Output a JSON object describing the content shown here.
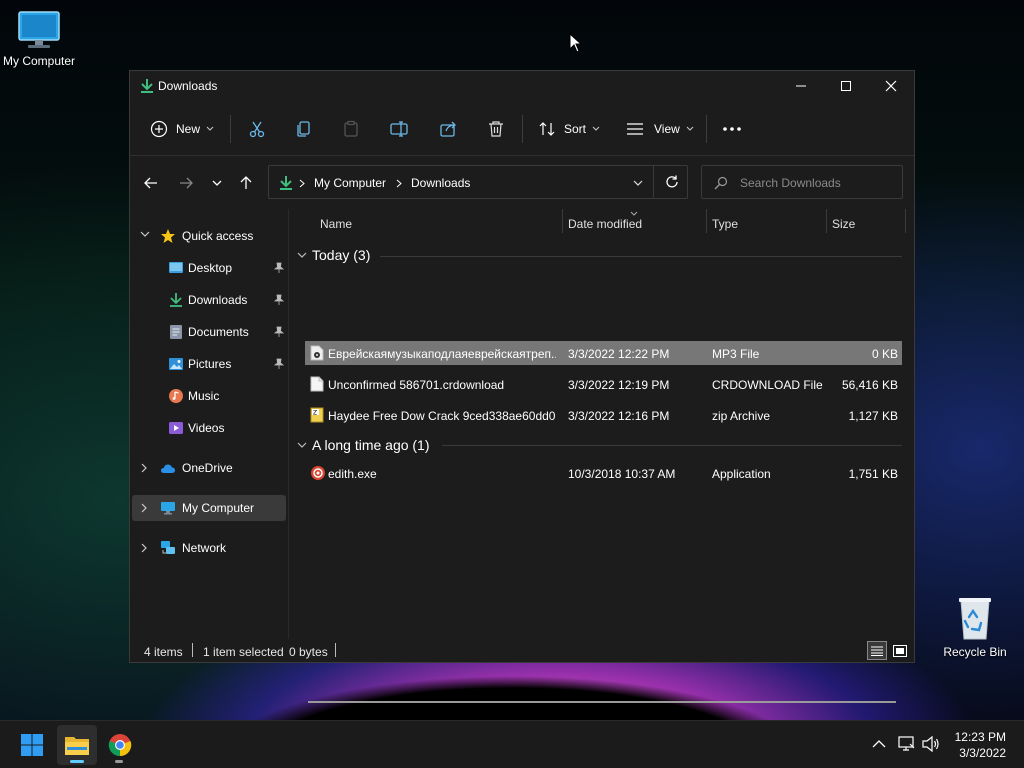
{
  "desktop": {
    "icons": [
      {
        "label": "My Computer",
        "icon": "computer-icon"
      },
      {
        "label": "Recycle Bin",
        "icon": "recycle-bin-icon"
      }
    ]
  },
  "window": {
    "title": "Downloads",
    "controls": [
      "minimize-icon",
      "maximize-icon",
      "close-icon"
    ]
  },
  "toolbar": {
    "new_label": "New",
    "sort_label": "Sort",
    "view_label": "View",
    "icons": [
      "cut-icon",
      "copy-icon",
      "paste-icon",
      "rename-icon",
      "share-icon",
      "delete-icon",
      "more-icon"
    ]
  },
  "address": {
    "segments": [
      "My Computer",
      "Downloads"
    ]
  },
  "search": {
    "placeholder": "Search Downloads"
  },
  "sidebar": {
    "quick_access": "Quick access",
    "items": [
      {
        "label": "Desktop",
        "pinned": true
      },
      {
        "label": "Downloads",
        "pinned": true
      },
      {
        "label": "Documents",
        "pinned": true
      },
      {
        "label": "Pictures",
        "pinned": true
      },
      {
        "label": "Music",
        "pinned": false
      },
      {
        "label": "Videos",
        "pinned": false
      }
    ],
    "onedrive": "OneDrive",
    "my_computer": "My Computer",
    "network": "Network"
  },
  "columns": {
    "name": "Name",
    "date": "Date modified",
    "type": "Type",
    "size": "Size"
  },
  "groups": [
    {
      "header": "Today (3)",
      "files": [
        {
          "name": "Еврейскаямузыкаподлаяеврейскаятреп...",
          "date": "3/3/2022 12:22 PM",
          "type": "MP3 File",
          "size": "0 KB",
          "selected": true
        },
        {
          "name": "Unconfirmed 586701.crdownload",
          "date": "3/3/2022 12:19 PM",
          "type": "CRDOWNLOAD File",
          "size": "56,416 KB",
          "selected": false
        },
        {
          "name": "Haydee Free Dow Crack 9ced338ae60dd0...",
          "date": "3/3/2022 12:16 PM",
          "type": "zip Archive",
          "size": "1,127 KB",
          "selected": false
        }
      ]
    },
    {
      "header": "A long time ago (1)",
      "files": [
        {
          "name": "edith.exe",
          "date": "10/3/2018 10:37 AM",
          "type": "Application",
          "size": "1,751 KB",
          "selected": false
        }
      ]
    }
  ],
  "status": {
    "items": "4 items",
    "selected": "1 item selected",
    "size": "0 bytes"
  },
  "taskbar": {
    "time": "12:23 PM",
    "date": "3/3/2022"
  },
  "colors": {
    "accent": "#60cdff",
    "download_green": "#3fbf7f",
    "window_bg": "#1c1c1c",
    "selected_row": "#777777"
  }
}
